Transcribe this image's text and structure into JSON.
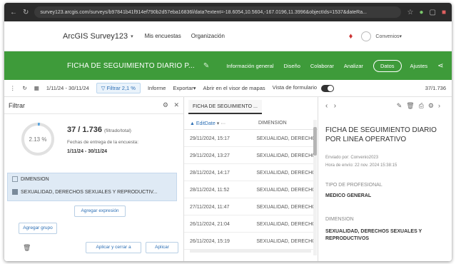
{
  "browser": {
    "url": "survey123.arcgis.com/surveys/b97841b41f914ef790b2d57eba16836l/data?extent=-18.6054,10.5604,-167.0196,11.3996&objectIds=1537&dateRa..."
  },
  "header": {
    "brand": "ArcGIS Survey123",
    "links": [
      "Mis encuestas",
      "Organización"
    ],
    "user": "Convenios"
  },
  "survey_bar": {
    "title": "FICHA DE SEGUIMIENTO DIARIO P...",
    "tabs": [
      "Información general",
      "Diseño",
      "Colaborar",
      "Analizar",
      "Datos",
      "Ajustes"
    ],
    "active_tab": "Datos"
  },
  "toolbar": {
    "date_range": "1/11/24 - 30/11/24",
    "filter_label": "Filtrar 2,1 %",
    "report": "Informe",
    "export": "Exportar",
    "open_map": "Abrir en el visor de mapas",
    "form_view": "Vista de formulario",
    "count": "37/1.736"
  },
  "filter_panel": {
    "title": "Filtrar",
    "percent": "2.13 %",
    "percent_value": 2.13,
    "stat_main": "37 / 1.736",
    "stat_sub": "(filtrado/total)",
    "date_label": "Fechas de entrega de la encuesta:",
    "date_range": "1/11/24 - 30/11/24",
    "dimension_title": "DIMENSION",
    "dimension_value": "SEXUALIDAD, DERECHOS SEXUALES Y REPRODUCTIV...",
    "add_expression": "Agregar expresión",
    "add_group": "Agregar grupo",
    "apply_close": "Aplicar y cerrar a",
    "apply": "Aplicar"
  },
  "records": {
    "tab": "FICHA DE SEGUIMIENTO ...",
    "col_date": "EditDate",
    "col_dim": "DIMENSION",
    "rows": [
      {
        "date": "29/11/2024, 15:17",
        "dim": "SEXUALIDAD, DERECHC"
      },
      {
        "date": "29/11/2024, 13:27",
        "dim": "SEXUALIDAD, DERECHC"
      },
      {
        "date": "28/11/2024, 14:17",
        "dim": "SEXUALIDAD, DERECHC"
      },
      {
        "date": "28/11/2024, 11:52",
        "dim": "SEXUALIDAD, DERECHC"
      },
      {
        "date": "27/11/2024, 11:47",
        "dim": "SEXUALIDAD, DERECHC"
      },
      {
        "date": "26/11/2024, 21:04",
        "dim": "SEXUALIDAD, DERECHC"
      },
      {
        "date": "26/11/2024, 15:19",
        "dim": "SEXUALIDAD, DERECHC"
      }
    ]
  },
  "detail": {
    "title": "FICHA DE SEGUIMIENTO DIARIO POR LINEA OPERATIVO",
    "sent_by_label": "Enviado por:",
    "sent_by": "Convenio2023",
    "sent_time_label": "Hora de envío:",
    "sent_time": "22 nov. 2024 15:38:15",
    "field1_label": "TIPO DE PROFESIONAL",
    "field1_value": "MEDICO GENERAL",
    "field2_label": "DIMENSION",
    "field2_value": "SEXUALIDAD, DERECHOS SEXUALES Y REPRODUCTIVOS"
  },
  "colors": {
    "green": "#3e9b3a",
    "accent": "#2c6fb5",
    "ring": "#5aa3dc"
  }
}
